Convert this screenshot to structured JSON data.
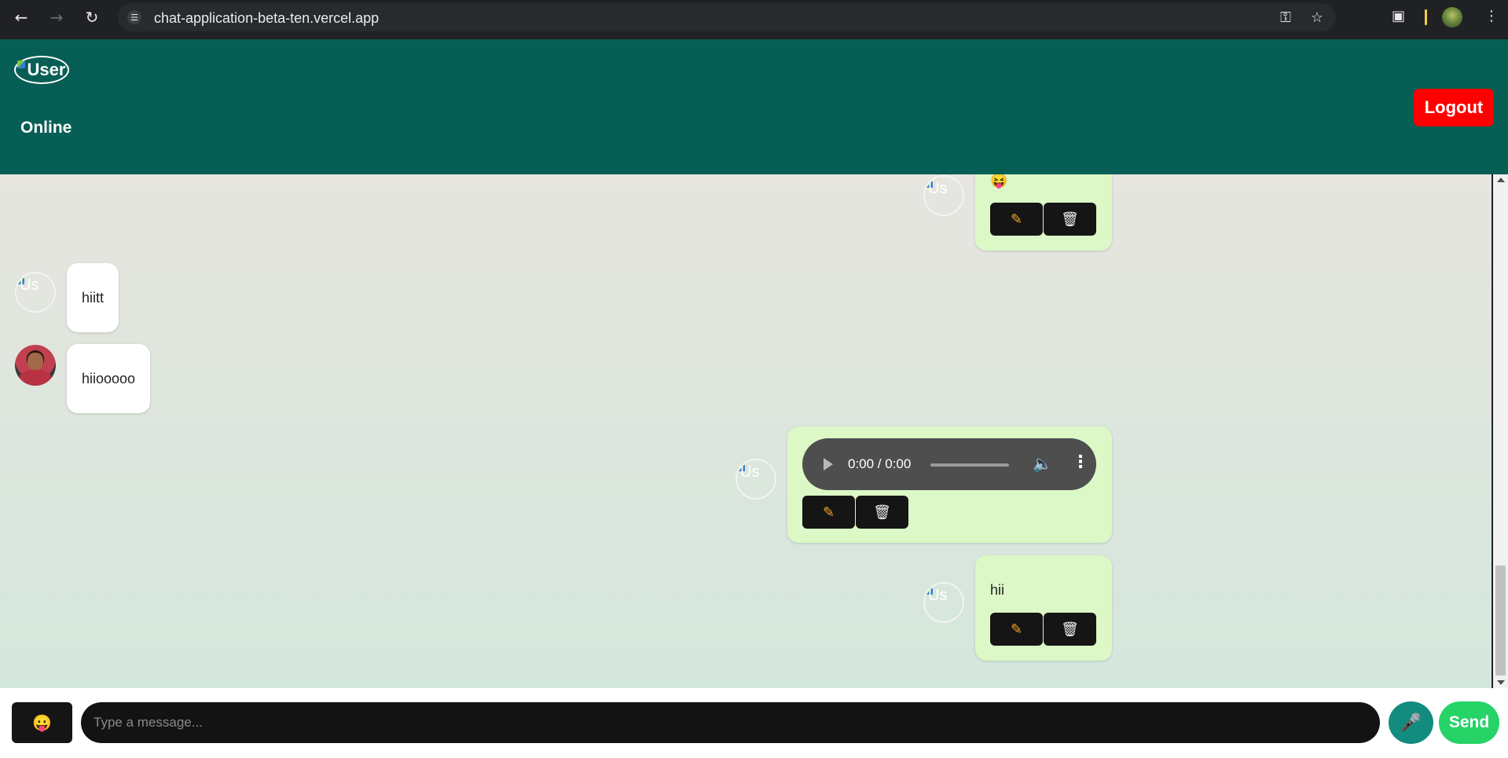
{
  "browser": {
    "url": "chat-application-beta-ten.vercel.app",
    "back_icon": "arrow-left-icon",
    "forward_icon": "arrow-right-icon",
    "reload_icon": "reload-icon"
  },
  "header": {
    "avatar_alt": "User",
    "status": "Online",
    "logout_label": "Logout",
    "background_color": "#075e54",
    "logout_color": "#ff0000"
  },
  "messages": [
    {
      "direction": "outgoing",
      "type": "emoji",
      "text": "😝",
      "avatar_alt": "Us"
    },
    {
      "direction": "incoming",
      "type": "text",
      "text": "hiitt",
      "avatar_alt": "Us"
    },
    {
      "direction": "incoming",
      "type": "text",
      "text": "hiiooooo",
      "avatar": "photo"
    },
    {
      "direction": "outgoing",
      "type": "audio",
      "time": "0:00 / 0:00",
      "avatar_alt": "Us"
    },
    {
      "direction": "outgoing",
      "type": "text",
      "text": "hii",
      "avatar_alt": "Us"
    }
  ],
  "actions": {
    "edit_icon": "pencil-icon",
    "delete_icon": "trash-icon"
  },
  "composer": {
    "emoji_label": "😛",
    "placeholder": "Type a message...",
    "mic_icon": "microphone-icon",
    "send_label": "Send",
    "send_color": "#25d366"
  }
}
